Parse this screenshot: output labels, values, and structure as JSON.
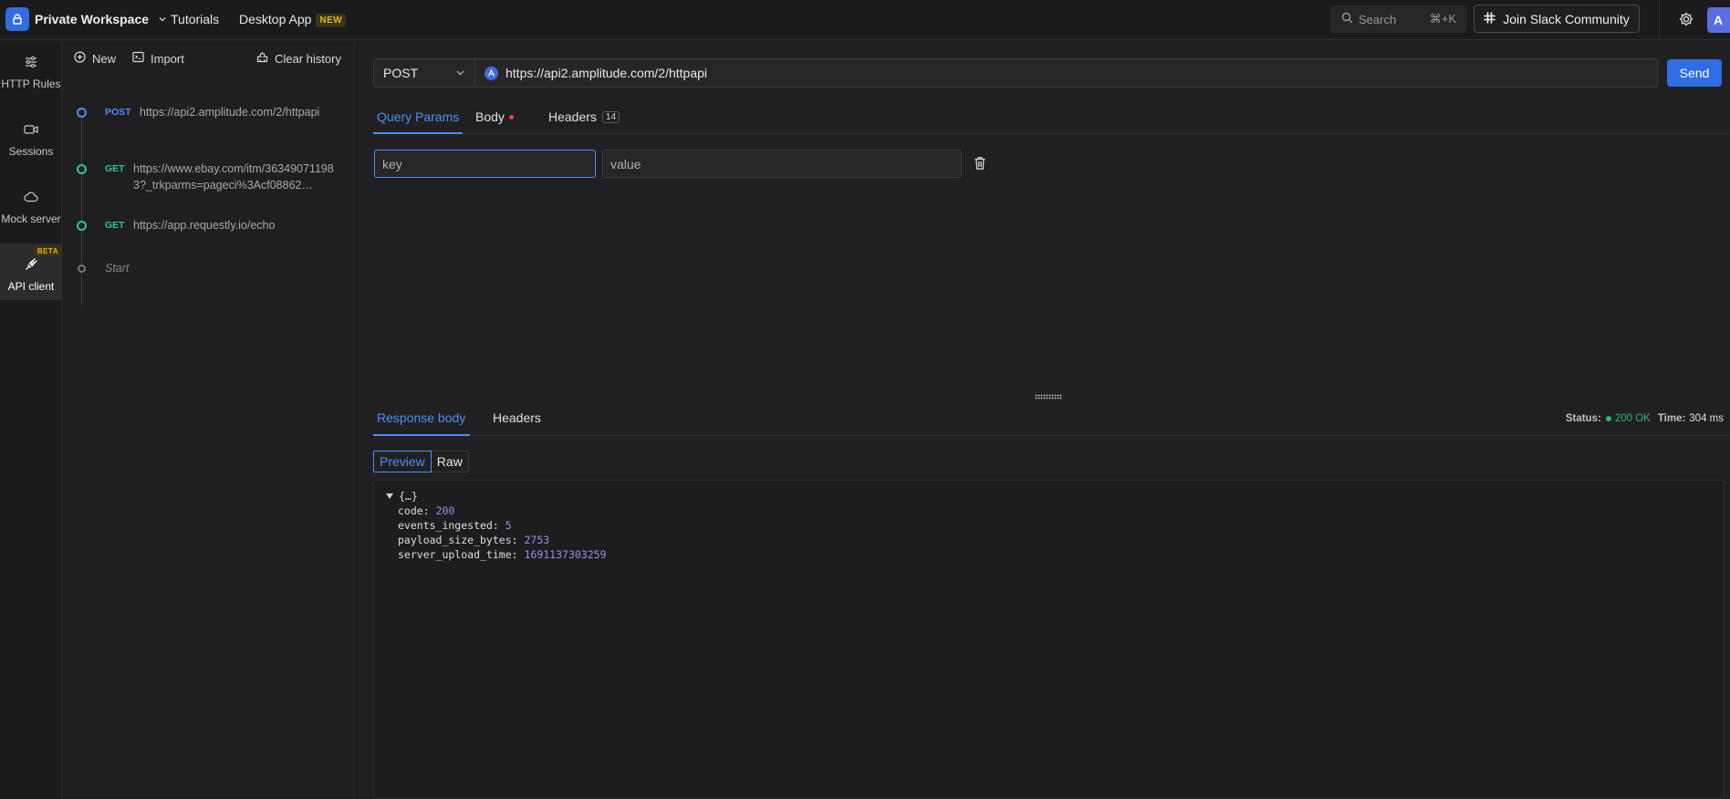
{
  "topbar": {
    "workspace": "Private Workspace",
    "tutorials": "Tutorials",
    "desktop_app": "Desktop App",
    "new_badge": "NEW",
    "search_label": "Search",
    "search_shortcut": "⌘+K",
    "slack_label": "Join Slack Community",
    "avatar_initial": "A"
  },
  "rail": {
    "items": [
      {
        "label": "HTTP Rules",
        "icon": "sliders-icon"
      },
      {
        "label": "Sessions",
        "icon": "video-icon"
      },
      {
        "label": "Mock server",
        "icon": "cloud-icon"
      },
      {
        "label": "API client",
        "icon": "plug-icon",
        "badge": "BETA",
        "active": true
      }
    ]
  },
  "history": {
    "new_label": "New",
    "import_label": "Import",
    "clear_label": "Clear history",
    "entries": [
      {
        "method": "POST",
        "url": "https://api2.amplitude.com/2/httpapi"
      },
      {
        "method": "GET",
        "url": "https://www.ebay.com/itm/363490711983?_trkparms=pageci%3Acf08862…"
      },
      {
        "method": "GET",
        "url": "https://app.requestly.io/echo"
      }
    ],
    "start_label": "Start"
  },
  "request": {
    "method": "POST",
    "url": "https://api2.amplitude.com/2/httpapi",
    "send_label": "Send",
    "tabs": {
      "query": "Query Params",
      "body": "Body",
      "headers": "Headers",
      "headers_count": "14"
    },
    "param_key_placeholder": "key",
    "param_value_placeholder": "value"
  },
  "response": {
    "tabs": {
      "body": "Response body",
      "headers": "Headers"
    },
    "status_label": "Status:",
    "status_value": "200 OK",
    "time_label": "Time:",
    "time_value": "304 ms",
    "view_preview": "Preview",
    "view_raw": "Raw",
    "root_label": "{…}",
    "fields": [
      {
        "key": "code",
        "value": "200"
      },
      {
        "key": "events_ingested",
        "value": "5"
      },
      {
        "key": "payload_size_bytes",
        "value": "2753"
      },
      {
        "key": "server_upload_time",
        "value": "1691137303259"
      }
    ]
  },
  "colors": {
    "accent": "#2f6de1",
    "post": "#4c8ef7",
    "get": "#29c5a5",
    "ok": "#2cb673"
  }
}
